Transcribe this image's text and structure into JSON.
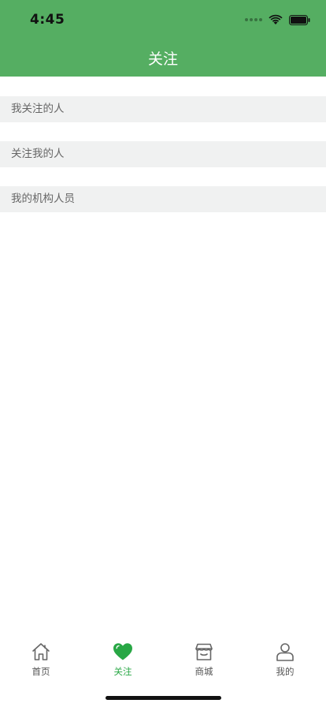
{
  "colors": {
    "brand": "#55ae62",
    "active": "#28a745",
    "section_bg": "#f0f1f1"
  },
  "status_bar": {
    "time": "4:45",
    "icons": [
      "cellular-icon",
      "wifi-icon",
      "battery-icon"
    ]
  },
  "header": {
    "title": "关注"
  },
  "sections": [
    {
      "label": "我关注的人"
    },
    {
      "label": "关注我的人"
    },
    {
      "label": "我的机构人员"
    }
  ],
  "tabbar": {
    "active_index": 1,
    "items": [
      {
        "label": "首页",
        "icon": "home-icon"
      },
      {
        "label": "关注",
        "icon": "heart-icon"
      },
      {
        "label": "商城",
        "icon": "store-icon"
      },
      {
        "label": "我的",
        "icon": "person-icon"
      }
    ]
  }
}
